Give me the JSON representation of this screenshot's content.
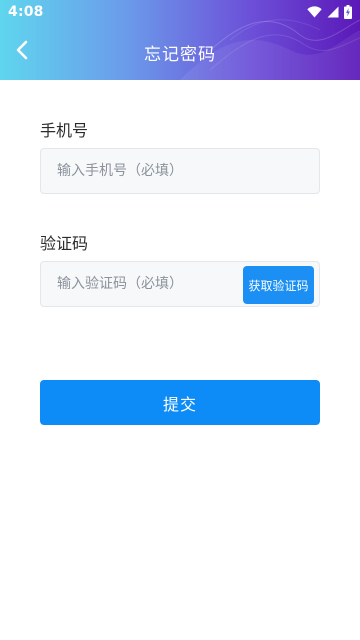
{
  "status_bar": {
    "time": "4:08",
    "icons": [
      "wifi-icon",
      "signal-icon",
      "battery-charging-icon"
    ]
  },
  "header": {
    "title": "忘记密码",
    "back_icon": "chevron-left-icon"
  },
  "form": {
    "phone": {
      "label": "手机号",
      "placeholder": "输入手机号（必填）",
      "value": ""
    },
    "code": {
      "label": "验证码",
      "placeholder": "输入验证码（必填）",
      "value": "",
      "get_code_label": "获取验证码"
    },
    "submit_label": "提交"
  },
  "colors": {
    "header_gradient": [
      "#5fd6ee",
      "#6b9bea",
      "#6c4fd8",
      "#5b18b8"
    ],
    "primary_button": "#0d8bf6",
    "code_button": "#1b8ff3",
    "field_background": "#f6f8fa",
    "field_border": "#e3e6ea"
  }
}
